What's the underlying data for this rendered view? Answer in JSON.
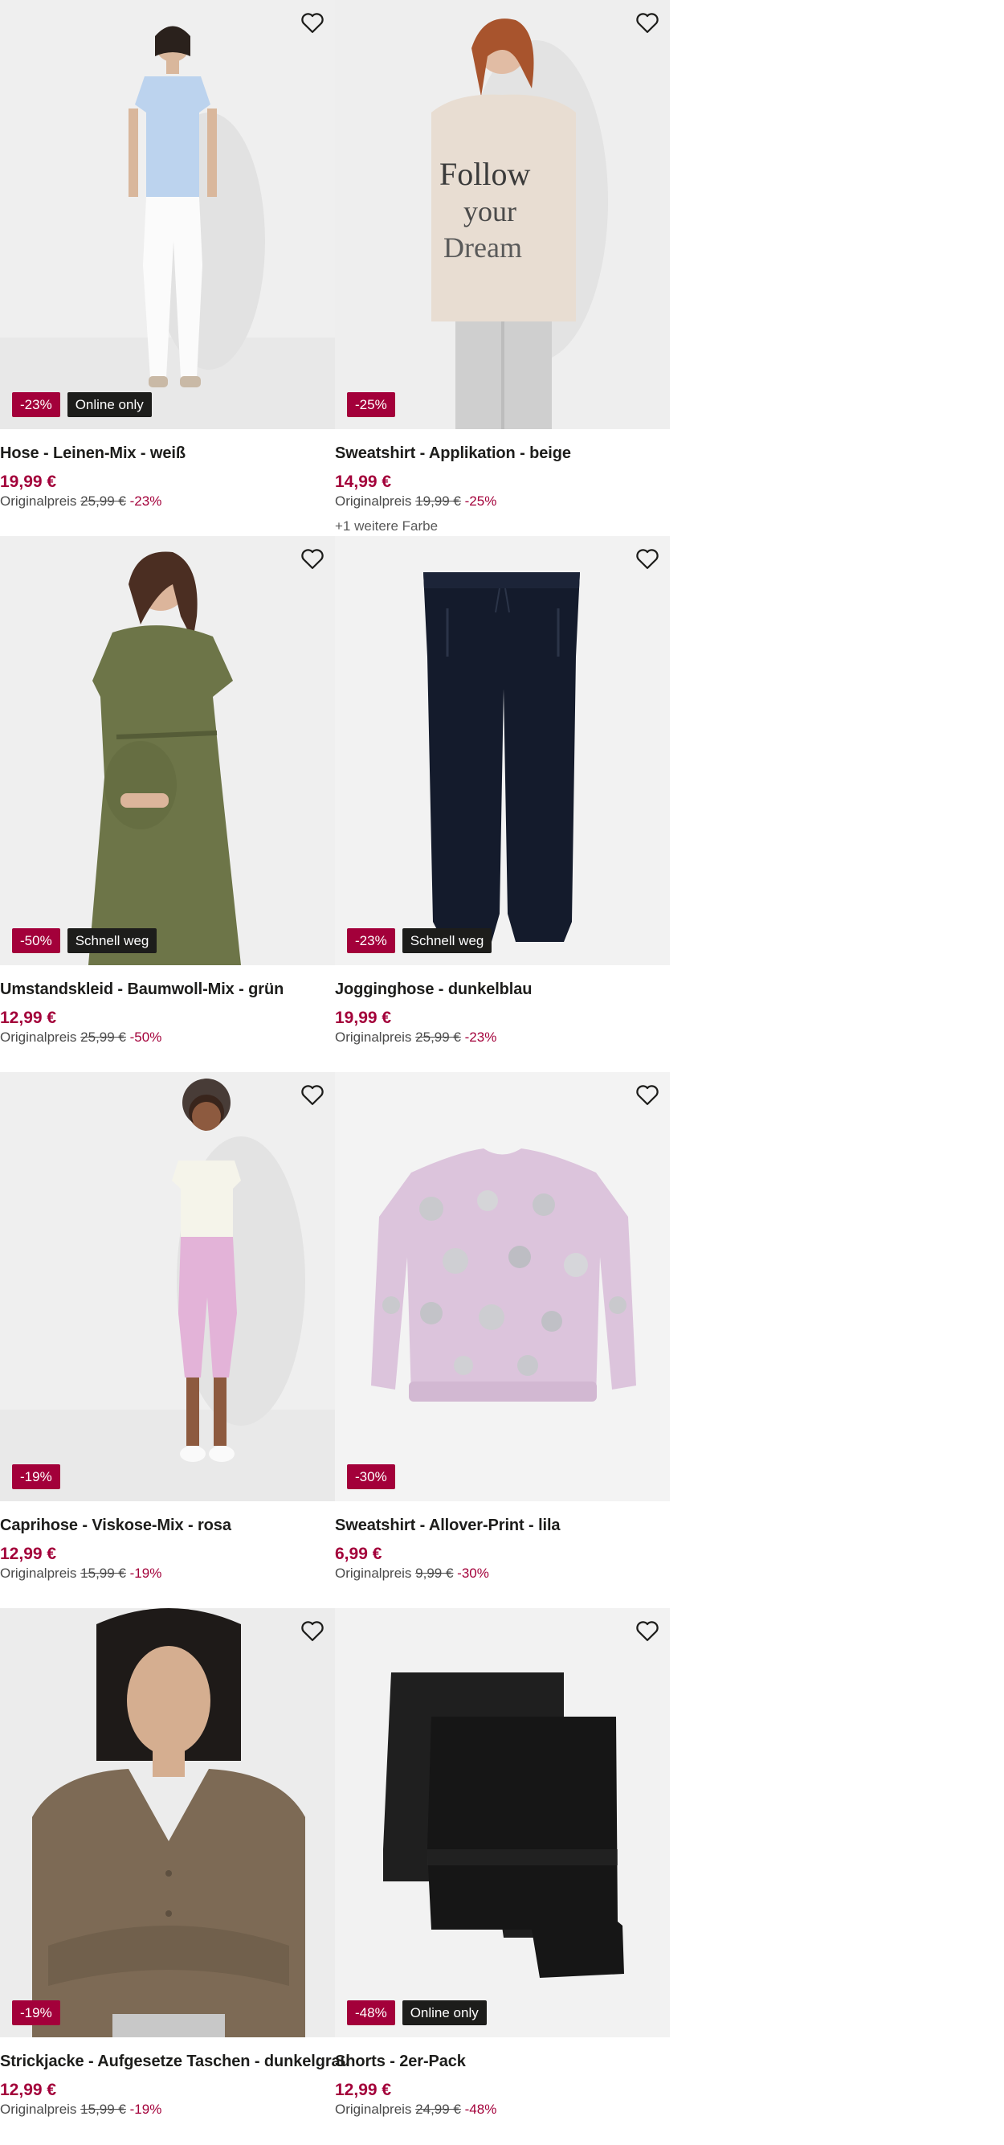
{
  "products": [
    {
      "title": "Hose - Leinen-Mix - weiß",
      "price": "19,99 €",
      "orig_label": "Originalpreis",
      "orig_price": "25,99 €",
      "orig_pct": "-23%",
      "badges": [
        "-23%",
        "Online only"
      ],
      "more": "",
      "image": "woman-white-linen-trousers"
    },
    {
      "title": "Sweatshirt - Applikation - beige",
      "price": "14,99 €",
      "orig_label": "Originalpreis",
      "orig_price": "19,99 €",
      "orig_pct": "-25%",
      "badges": [
        "-25%"
      ],
      "more": "+1 weitere Farbe",
      "image": "woman-beige-sweatshirt"
    },
    {
      "title": "Umstandskleid - Baumwoll-Mix - grün",
      "price": "12,99 €",
      "orig_label": "Originalpreis",
      "orig_price": "25,99 €",
      "orig_pct": "-50%",
      "badges": [
        "-50%",
        "Schnell weg"
      ],
      "more": "",
      "image": "woman-green-maternity-dress"
    },
    {
      "title": "Jogginghose - dunkelblau",
      "price": "19,99 €",
      "orig_label": "Originalpreis",
      "orig_price": "25,99 €",
      "orig_pct": "-23%",
      "badges": [
        "-23%",
        "Schnell weg"
      ],
      "more": "",
      "image": "navy-jogging-pants"
    },
    {
      "title": "Caprihose - Viskose-Mix - rosa",
      "price": "12,99 €",
      "orig_label": "Originalpreis",
      "orig_price": "15,99 €",
      "orig_pct": "-19%",
      "badges": [
        "-19%"
      ],
      "more": "",
      "image": "woman-pink-capri-pants"
    },
    {
      "title": "Sweatshirt - Allover-Print - lila",
      "price": "6,99 €",
      "orig_label": "Originalpreis",
      "orig_price": "9,99 €",
      "orig_pct": "-30%",
      "badges": [
        "-30%"
      ],
      "more": "",
      "image": "lilac-dotted-sweatshirt"
    },
    {
      "title": "Strickjacke - Aufgesetze Taschen - dunkelgrau",
      "price": "12,99 €",
      "orig_label": "Originalpreis",
      "orig_price": "15,99 €",
      "orig_pct": "-19%",
      "badges": [
        "-19%"
      ],
      "more": "",
      "image": "woman-taupe-cardigan"
    },
    {
      "title": "Shorts - 2er-Pack",
      "price": "12,99 €",
      "orig_label": "Originalpreis",
      "orig_price": "24,99 €",
      "orig_pct": "-48%",
      "badges": [
        "-48%",
        "Online only"
      ],
      "more": "",
      "image": "black-shorts-two-pack"
    }
  ],
  "colors": {
    "discount_badge": "#a3003a",
    "flag_badge": "#1d1d1b",
    "price": "#a3003a",
    "image_bg": "#f0f0f0"
  },
  "icons": {
    "favorite": "heart-outline-icon"
  }
}
